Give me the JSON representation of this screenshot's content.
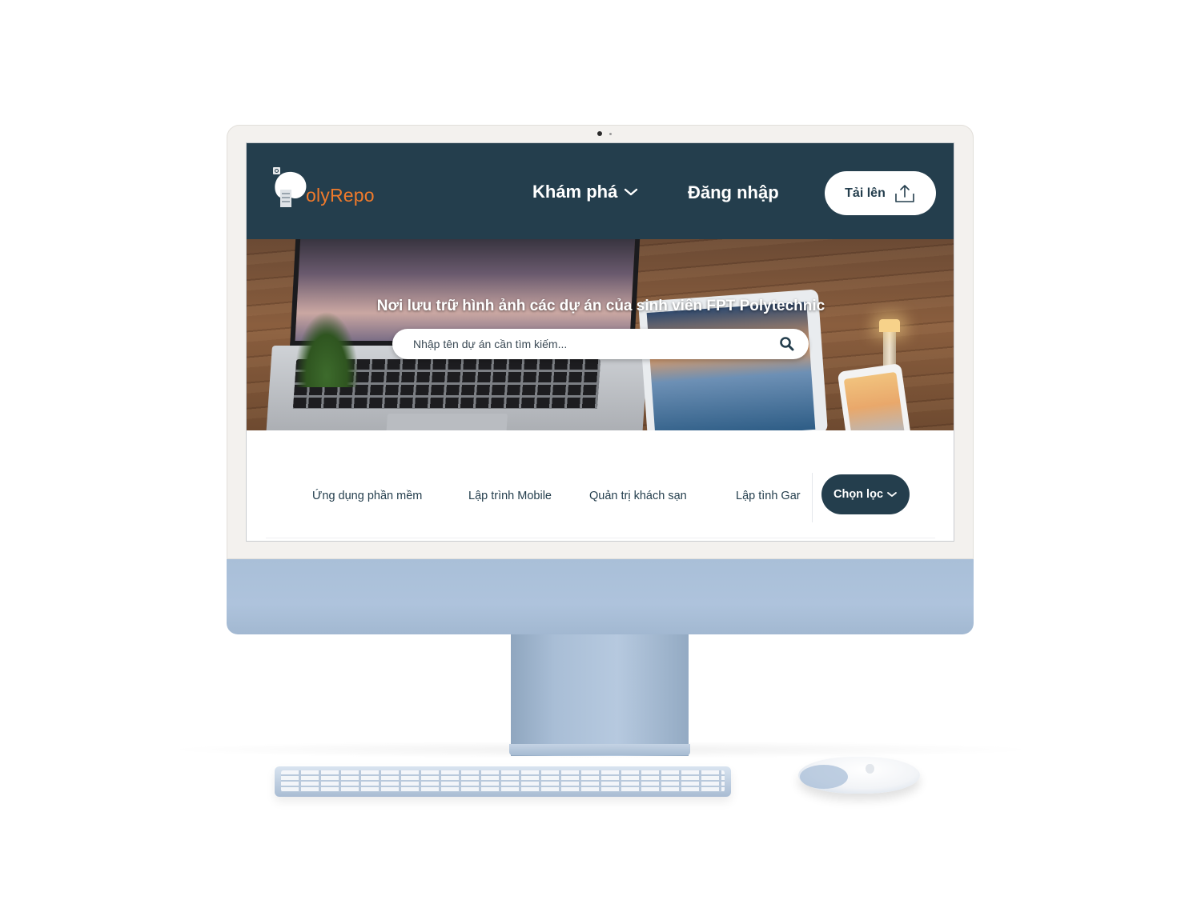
{
  "colors": {
    "navbar_bg": "#243e4d",
    "logo_accent": "#f07a2b",
    "filter_button_bg": "#243e4d",
    "device_chin": "#aec3dc"
  },
  "header": {
    "logo_text": "olyRepo",
    "explore_label": "Khám phá",
    "login_label": "Đăng nhập",
    "upload_label": "Tải lên",
    "icons": {
      "logo": "logo-mascot-icon",
      "explore": "chevron-down-icon",
      "upload": "upload-icon"
    }
  },
  "hero": {
    "title": "Nơi lưu trữ hình ảnh các dự án của sinh viên FPT Polytechnic",
    "search": {
      "placeholder": "Nhập tên dự án cần tìm kiếm...",
      "value": "",
      "icon": "search-icon"
    }
  },
  "categories": {
    "items": [
      {
        "label": "Ứng dụng phần mềm"
      },
      {
        "label": "Lập trình Mobile"
      },
      {
        "label": "Quản trị khách sạn"
      },
      {
        "label": "Lập tình Gar"
      }
    ],
    "filter_label": "Chọn lọc",
    "filter_icon": "chevron-down-icon"
  }
}
